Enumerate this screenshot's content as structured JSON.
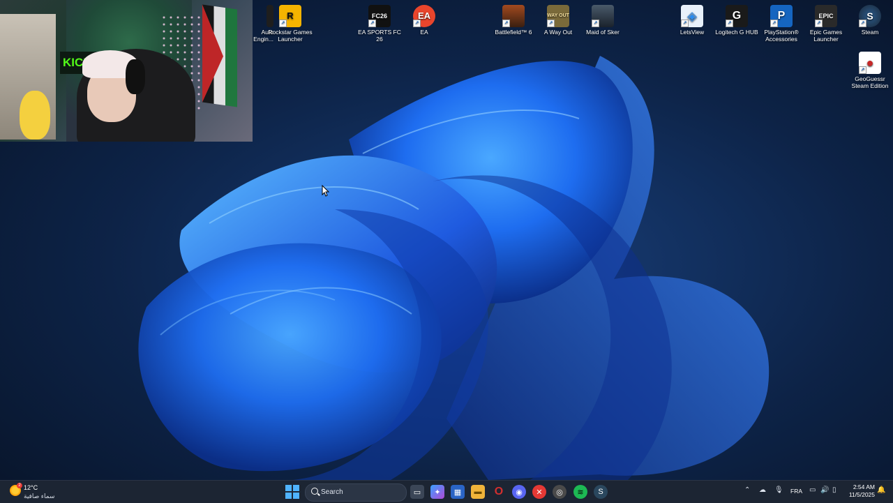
{
  "desktop": {
    "icons": [
      {
        "label": "Auto\nEngin...",
        "color": "#1e1e1e",
        "glyph": ""
      },
      {
        "label": "Rockstar Games Launcher",
        "color": "#f5b400",
        "glyph": "R"
      },
      {
        "label": "EA SPORTS FC 26",
        "color": "#111111",
        "glyph": "FC26"
      },
      {
        "label": "EA",
        "color": "#e8452c",
        "glyph": "EA"
      },
      {
        "label": "Battlefield™ 6",
        "color": "#6b3a1f",
        "glyph": ""
      },
      {
        "label": "A Way Out",
        "color": "#7a6a3a",
        "glyph": "WAY OUT"
      },
      {
        "label": "Maid of Sker",
        "color": "#2a3340",
        "glyph": ""
      },
      {
        "label": "LetsView",
        "color": "#e8f1fb",
        "glyph": "◈"
      },
      {
        "label": "Logitech G HUB",
        "color": "#1a1a1a",
        "glyph": "G"
      },
      {
        "label": "PlayStation® Accessories",
        "color": "#1565c0",
        "glyph": "P"
      },
      {
        "label": "Epic Games Launcher",
        "color": "#2a2a2a",
        "glyph": "EPIC"
      },
      {
        "label": "Steam",
        "color": "#1b2838",
        "glyph": "S"
      },
      {
        "label": "GeoGuessr Steam Edition",
        "color": "#c62828",
        "glyph": "●"
      }
    ]
  },
  "webcam": {
    "overlay_text": "KICK"
  },
  "taskbar": {
    "weather": {
      "temp": "12°C",
      "condition": "سماء صافية",
      "badge": "2",
      "icon": "sun-icon"
    },
    "search_placeholder": "Search",
    "apps": [
      {
        "name": "task-view",
        "color": "#3b4657",
        "glyph": "▭"
      },
      {
        "name": "copilot",
        "color": "#6b5bd6",
        "glyph": "✦"
      },
      {
        "name": "microsoft-store",
        "color": "#2a64c5",
        "glyph": "▦"
      },
      {
        "name": "file-explorer",
        "color": "#f0b43a",
        "glyph": "▬"
      },
      {
        "name": "opera",
        "color": "#d32f2f",
        "glyph": "O"
      },
      {
        "name": "discord",
        "color": "#5865f2",
        "glyph": "◉"
      },
      {
        "name": "app-red",
        "color": "#e53935",
        "glyph": "✕"
      },
      {
        "name": "chrome",
        "color": "#4a4a4a",
        "glyph": "◎"
      },
      {
        "name": "spotify",
        "color": "#1db954",
        "glyph": "≋"
      },
      {
        "name": "steam",
        "color": "#2a475e",
        "glyph": "S"
      }
    ],
    "language": "FRA",
    "time": "2:54 AM",
    "date": "11/5/2025"
  },
  "colors": {
    "accent": "#4fb3ff",
    "taskbar_bg": "#1c2533"
  }
}
